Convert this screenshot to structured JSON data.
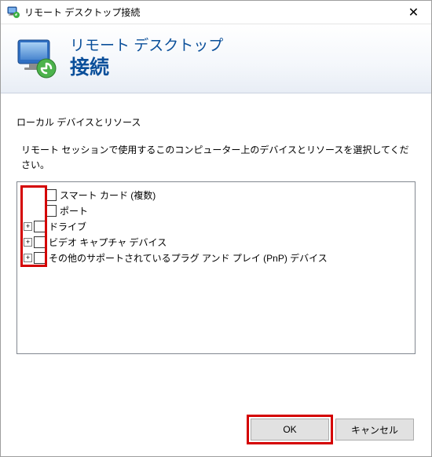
{
  "window": {
    "title": "リモート デスクトップ接続"
  },
  "header": {
    "line1": "リモート デスクトップ",
    "line2": "接続"
  },
  "section_title": "ローカル デバイスとリソース",
  "instruction": "リモート セッションで使用するこのコンピューター上のデバイスとリソースを選択してください。",
  "tree": {
    "items": [
      {
        "label": "スマート カード (複数)",
        "expandable": false,
        "indent": 1
      },
      {
        "label": "ポート",
        "expandable": false,
        "indent": 1
      },
      {
        "label": "ドライブ",
        "expandable": true,
        "indent": 0
      },
      {
        "label": "ビデオ キャプチャ デバイス",
        "expandable": true,
        "indent": 0
      },
      {
        "label": "その他のサポートされているプラグ アンド プレイ (PnP) デバイス",
        "expandable": true,
        "indent": 0
      }
    ]
  },
  "buttons": {
    "ok": "OK",
    "cancel": "キャンセル"
  },
  "icons": {
    "close": "✕",
    "expand": "+"
  }
}
